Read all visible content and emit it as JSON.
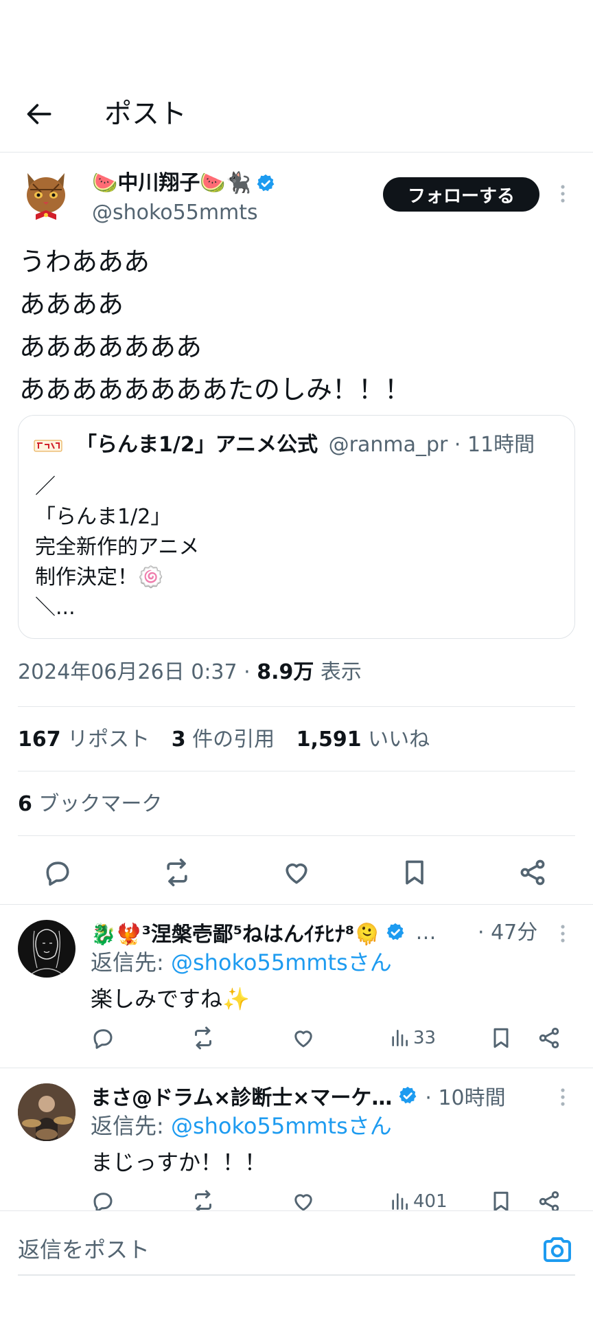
{
  "header": {
    "title": "ポスト"
  },
  "post": {
    "author": {
      "display_name": "🍉中川翔子🍉🐈‍⬛",
      "handle": "@shoko55mmts"
    },
    "follow_label": "フォローする",
    "body_lines": [
      "うわあああ",
      "ああああ",
      "あああああああ",
      "ああああああああたのしみ！！！"
    ],
    "quote": {
      "display_name": "「らんま1/2」アニメ公式",
      "handle": "@ranma_pr",
      "time": "· 11時間",
      "lines": [
        "／",
        "「らんま1/2」",
        "完全新作的アニメ",
        "制作決定！🍥",
        "＼..."
      ]
    },
    "timestamp": "2024年06月26日 0:37 · ",
    "views_count": "8.9万",
    "views_label": " 表示",
    "stats": {
      "reposts_count": "167",
      "reposts_label": " リポスト",
      "quotes_count": "3",
      "quotes_label": " 件の引用",
      "likes_count": "1,591",
      "likes_label": " いいね",
      "bookmarks_count": "6",
      "bookmarks_label": " ブックマーク"
    }
  },
  "replies": [
    {
      "display_name": "🐉🐦‍🔥³涅槃壱鄙⁵ねはんｲﾁﾋﾅ⁸🫠",
      "ellipsis": "…",
      "time": "· 47分",
      "reply_to_prefix": "返信先: ",
      "reply_to_handle": "@shoko55mmtsさん",
      "text": "楽しみですね✨",
      "views": "33"
    },
    {
      "display_name": "まさ@ドラム×診断士×マーケ…",
      "time": "· 10時間",
      "reply_to_prefix": "返信先: ",
      "reply_to_handle": "@shoko55mmtsさん",
      "text": "まじっすか！！！",
      "views": "401"
    }
  ],
  "composer": {
    "placeholder": "返信をポスト"
  },
  "colors": {
    "accent": "#1d9bf0",
    "text": "#0f1419",
    "secondary": "#536471",
    "follow_button": "#0f1419"
  }
}
